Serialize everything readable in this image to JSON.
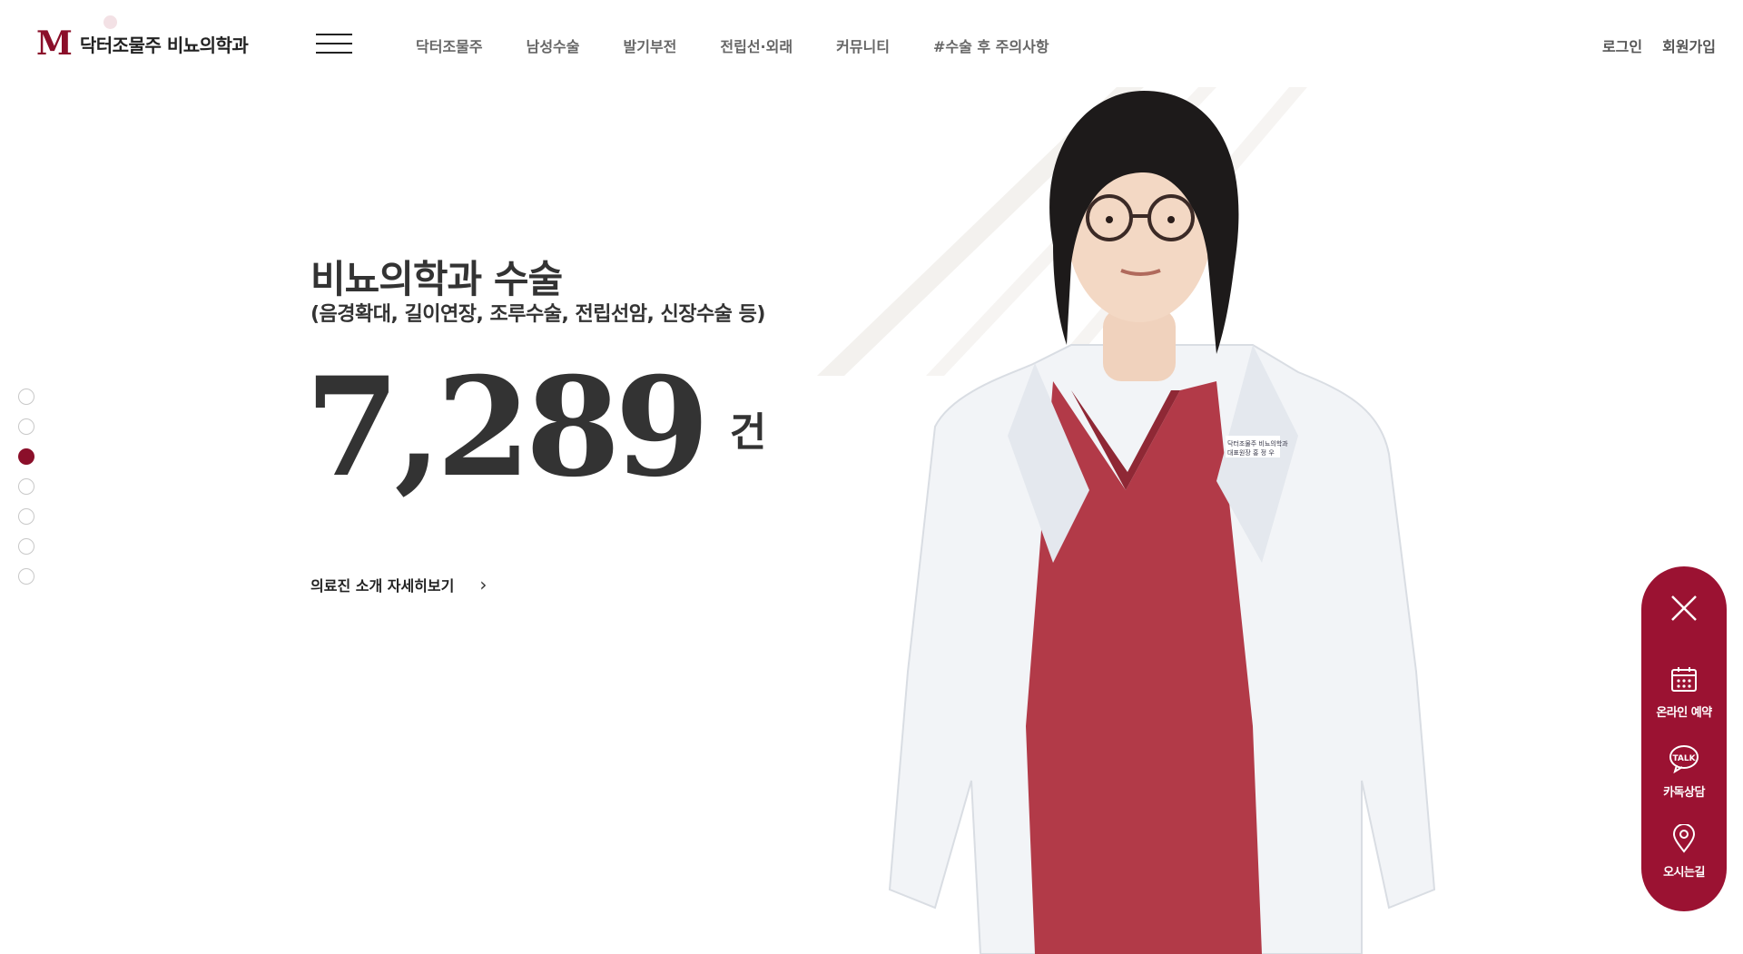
{
  "header": {
    "logo_mark": "M",
    "logo_text": "닥터조물주 비뇨의학과",
    "nav": [
      "닥터조물주",
      "남성수술",
      "발기부전",
      "전립선·외래",
      "커뮤니티",
      "#수술 후 주의사항"
    ],
    "user_links": [
      "로그인",
      "회원가입"
    ]
  },
  "hero": {
    "title": "비뇨의학과 수술",
    "subtitle": "(음경확대, 길이연장, 조루수술, 전립선암, 신장수술 등)",
    "count": "7,289",
    "count_unit": "건",
    "detail_link": "의료진 소개 자세히보기"
  },
  "pagination": {
    "total": 7,
    "active_index": 2
  },
  "quick_menu": {
    "items": [
      {
        "label": "온라인 예약",
        "icon": "calendar-icon"
      },
      {
        "label": "카독상담",
        "icon": "talk-icon",
        "badge": "TALK"
      },
      {
        "label": "오시는길",
        "icon": "location-pin-icon"
      }
    ]
  },
  "doctor": {
    "badge_line1": "닥터조물주 비뇨의학과",
    "badge_line2": "대표원장 홍 정 우"
  },
  "colors": {
    "accent": "#9b1232",
    "dot_active": "#8b0f2a",
    "text": "#333333",
    "nav": "#666666"
  }
}
